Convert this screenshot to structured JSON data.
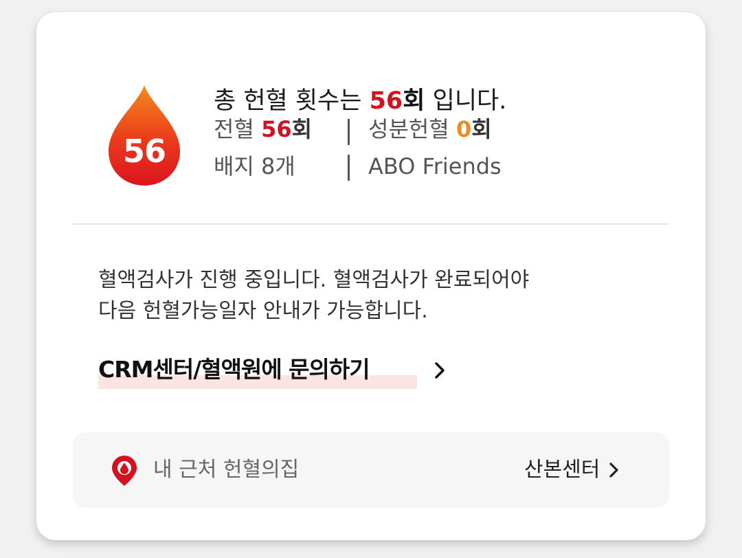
{
  "summary": {
    "count_badge": "56",
    "headline_prefix": "총 헌혈 횟수는 ",
    "headline_num": "56",
    "headline_unit": "회",
    "headline_suffix": " 입니다."
  },
  "stats": {
    "whole_label": "전혈 ",
    "whole_num": "56",
    "whole_unit": "회",
    "component_label": "성분헌혈 ",
    "component_num": "0",
    "component_unit": "회",
    "badge_text": "배지 8개",
    "group_text": "ABO Friends"
  },
  "notice": {
    "line1": "혈액검사가 진행 중입니다. 혈액검사가 완료되어야",
    "line2": "다음 헌혈가능일자 안내가 가능합니다."
  },
  "inquiry": {
    "label": "CRM센터/혈액원에 문의하기"
  },
  "nearby": {
    "label": "내 근처 헌혈의집",
    "center_name": "산본센터"
  },
  "colors": {
    "accent_red": "#d4111e",
    "accent_orange": "#f08a24",
    "highlight": "#fde3e3"
  },
  "icons": {
    "drop": "blood-drop-icon",
    "pin": "location-pin-icon",
    "chevron": "chevron-right-icon"
  }
}
